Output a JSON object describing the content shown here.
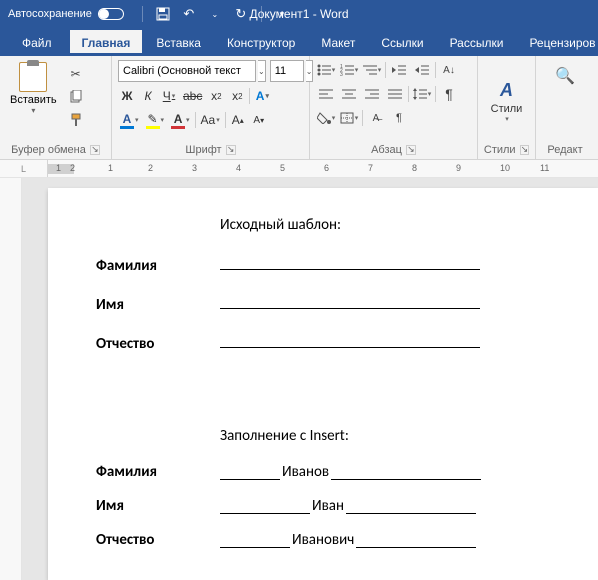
{
  "titlebar": {
    "autosave_label": "Автосохранение",
    "doc_title": "Документ1 - Word"
  },
  "tabs": {
    "file": "Файл",
    "home": "Главная",
    "insert": "Вставка",
    "design": "Конструктор",
    "layout": "Макет",
    "references": "Ссылки",
    "mailings": "Рассылки",
    "review": "Рецензиров"
  },
  "ribbon": {
    "clipboard": {
      "paste": "Вставить",
      "group_label": "Буфер обмена"
    },
    "font": {
      "name": "Calibri (Основной текст",
      "size": "11",
      "group_label": "Шрифт"
    },
    "paragraph": {
      "group_label": "Абзац"
    },
    "styles": {
      "label": "Стили",
      "group_label": "Стили"
    },
    "editing": {
      "label": "Редакт"
    }
  },
  "ruler": {
    "nums": [
      "1",
      "2",
      "1",
      "2",
      "3",
      "4",
      "5",
      "6",
      "7",
      "8",
      "9",
      "10",
      "11"
    ]
  },
  "document": {
    "section1_title": "Исходный шаблон:",
    "section2_title": "Заполнение с Insert:",
    "labels": {
      "surname": "Фамилия",
      "name": "Имя",
      "patronymic": "Отчество"
    },
    "values": {
      "surname": "Иванов",
      "name": "Иван",
      "patronymic": "Иванович"
    }
  }
}
